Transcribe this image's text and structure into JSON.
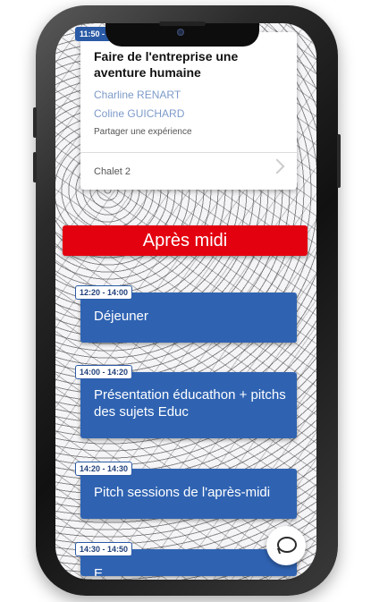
{
  "status_time": "11:50 - 12:",
  "session": {
    "title": "Faire de l'entreprise une aventure humaine",
    "speakers": [
      "Charline RENART",
      "Coline GUICHARD"
    ],
    "type": "Partager une expérience",
    "room": "Chalet 2"
  },
  "section": "Après midi",
  "items": [
    {
      "time": "12:20 - 14:00",
      "title": "Déjeuner"
    },
    {
      "time": "14:00 - 14:20",
      "title": "Présentation éducathon + pitchs des sujets Educ"
    },
    {
      "time": "14:20 - 14:30",
      "title": "Pitch sessions de l'après-midi"
    },
    {
      "time": "14:30 - 14:50",
      "title": "E"
    }
  ],
  "colors": {
    "accent_red": "#e3000f",
    "card_blue": "#2f63b2",
    "speaker_blue": "#7d9ac9"
  },
  "icons": {
    "chat": "chat-bubble-icon",
    "chevron": "chevron-right-icon"
  }
}
